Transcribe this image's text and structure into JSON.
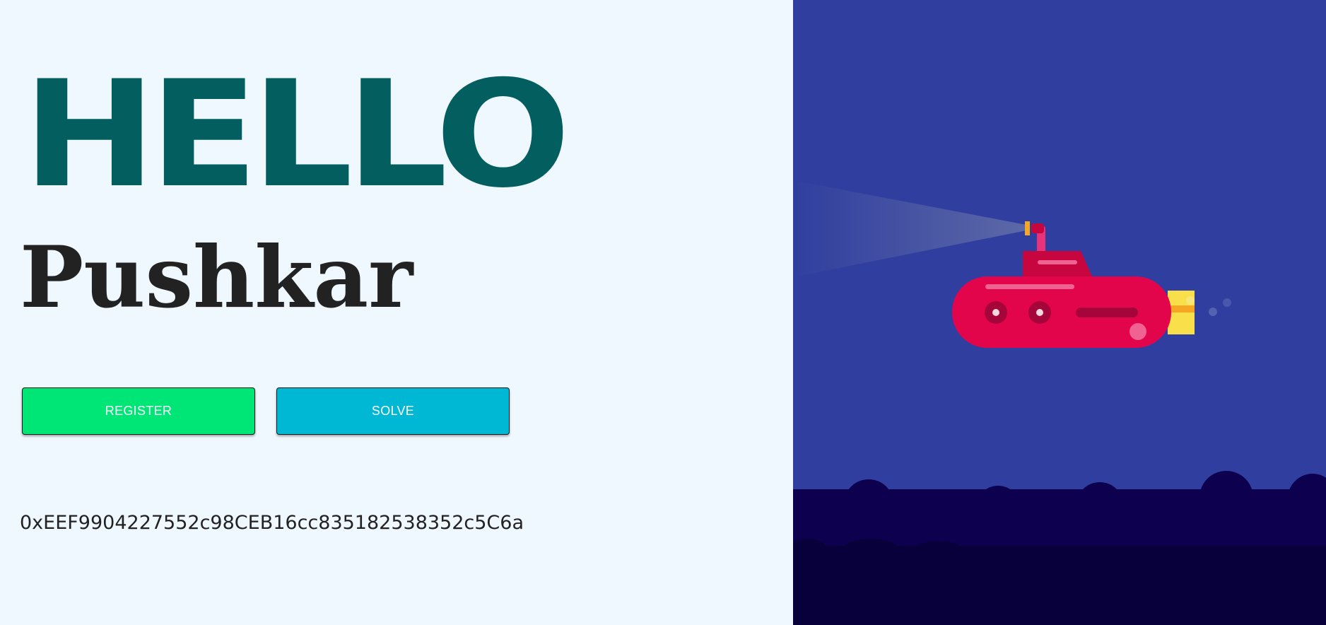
{
  "greeting": {
    "hello": "HELLO",
    "name": "Pushkar"
  },
  "actions": {
    "register_label": "REGISTER",
    "solve_label": "SOLVE"
  },
  "wallet": {
    "address": "0xEEF9904227552c98CEB16cc835182538352c5C6a"
  },
  "colors": {
    "background": "#f0f8ff",
    "hello_text": "#035e60",
    "register_button": "#00e676",
    "solve_button": "#00b8d4",
    "water": "#303e9f",
    "seabed": "#0d004f",
    "submarine_body": "#e3054c"
  },
  "illustration": {
    "icon": "submarine-icon"
  }
}
